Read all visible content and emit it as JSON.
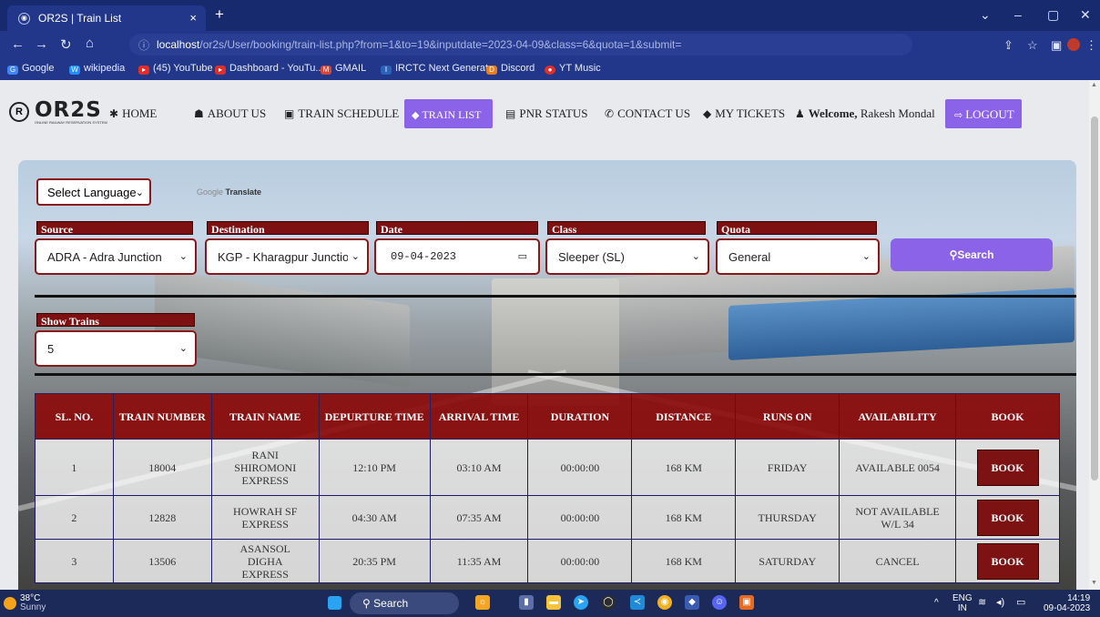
{
  "browser": {
    "tab_title": "OR2S | Train List",
    "tab_close": "×",
    "new_tab": "+",
    "url_host": "localhost",
    "url_rest": "/or2s/User/booking/train-list.php?from=1&to=19&inputdate=2023-04-09&class=6&quota=1&submit=",
    "bookmarks": [
      "Google",
      "wikipedia",
      "(45) YouTube",
      "Dashboard - YouTu...",
      "GMAIL",
      "IRCTC Next Generat...",
      "Discord",
      "YT Music"
    ]
  },
  "site": {
    "logo_text": "OR2S",
    "logo_sub": "ONLINE RAILWAY RESERVATION SYSTEM",
    "nav": {
      "home": "HOME",
      "about": "ABOUT US",
      "schedule": "TRAIN SCHEDULE",
      "train_list": "TRAIN LIST",
      "pnr": "PNR STATUS",
      "contact": "CONTACT US",
      "tickets": "MY TICKETS",
      "welcome": "Welcome,",
      "user": "Rakesh Mondal",
      "logout": "LOGOUT"
    }
  },
  "translate": {
    "select_language": "Select Language",
    "google": "Google",
    "translate": "Translate"
  },
  "form": {
    "source_label": "Source",
    "source_value": "ADRA - Adra Junction",
    "destination_label": "Destination",
    "destination_value": "KGP - Kharagpur Junction",
    "date_label": "Date",
    "date_value": "09-04-2023",
    "class_label": "Class",
    "class_value": "Sleeper (SL)",
    "quota_label": "Quota",
    "quota_value": "General",
    "search_label": "Search",
    "show_trains_label": "Show Trains",
    "show_trains_value": "5"
  },
  "table": {
    "headers": [
      "SL. NO.",
      "TRAIN NUMBER",
      "TRAIN NAME",
      "DEPURTURE TIME",
      "ARRIVAL TIME",
      "DURATION",
      "DISTANCE",
      "RUNS ON",
      "AVAILABILITY",
      "BOOK"
    ],
    "book_label": "BOOK",
    "rows": [
      {
        "sl": "1",
        "number": "18004",
        "name": "RANI SHIROMONI EXPRESS",
        "departure": "12:10 PM",
        "arrival": "03:10 AM",
        "duration": "00:00:00",
        "distance": "168 KM",
        "runs_on": "FRIDAY",
        "availability": "AVAILABLE 0054"
      },
      {
        "sl": "2",
        "number": "12828",
        "name": "HOWRAH SF EXPRESS",
        "departure": "04:30 AM",
        "arrival": "07:35 AM",
        "duration": "00:00:00",
        "distance": "168 KM",
        "runs_on": "THURSDAY",
        "availability": "NOT AVAILABLE W/L 34"
      },
      {
        "sl": "3",
        "number": "13506",
        "name": "ASANSOL DIGHA EXPRESS",
        "departure": "20:35 PM",
        "arrival": "11:35 AM",
        "duration": "00:00:00",
        "distance": "168 KM",
        "runs_on": "SATURDAY",
        "availability": "CANCEL"
      }
    ]
  },
  "taskbar": {
    "temperature": "38°C",
    "weather": "Sunny",
    "search": "Search",
    "lang_top": "ENG",
    "lang_bottom": "IN",
    "time": "14:19",
    "date": "09-04-2023"
  }
}
